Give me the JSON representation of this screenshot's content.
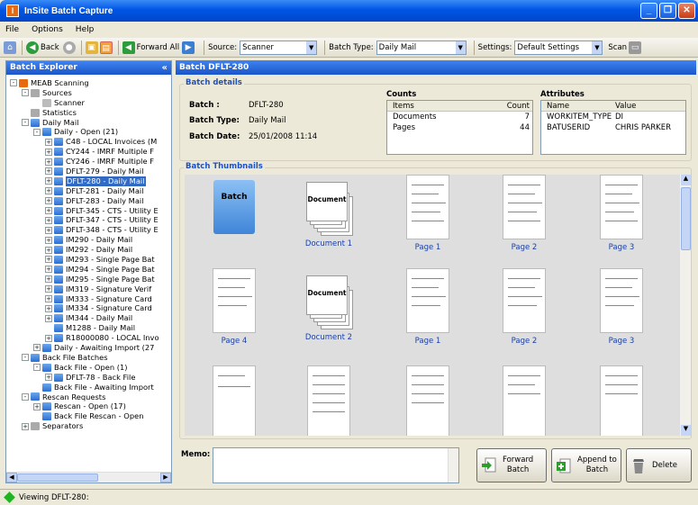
{
  "window": {
    "title": "InSite Batch Capture",
    "app_icon": "I"
  },
  "menu": [
    "File",
    "Options",
    "Help"
  ],
  "toolbar": {
    "back": "Back",
    "forward_all": "Forward All",
    "source_label": "Source:",
    "source_value": "Scanner",
    "batch_type_label": "Batch Type:",
    "batch_type_value": "Daily Mail",
    "settings_label": "Settings:",
    "settings_value": "Default Settings",
    "scan": "Scan"
  },
  "explorer": {
    "title": "Batch Explorer",
    "collapse": "«",
    "tree": [
      {
        "label": "MEAB Scanning",
        "level": 0,
        "pm": "-",
        "icon": "org"
      },
      {
        "label": "Sources",
        "level": 1,
        "pm": "-",
        "icon": "gray"
      },
      {
        "label": "Scanner",
        "level": 2,
        "pm": "",
        "icon": "scan"
      },
      {
        "label": "Statistics",
        "level": 1,
        "pm": "",
        "icon": "gray"
      },
      {
        "label": "Daily Mail",
        "level": 1,
        "pm": "-",
        "icon": "blue"
      },
      {
        "label": "Daily - Open (21)",
        "level": 2,
        "pm": "-",
        "icon": "blue"
      },
      {
        "label": "C48 - LOCAL Invoices (M",
        "level": 3,
        "pm": "+",
        "icon": "blue"
      },
      {
        "label": "CY244 - IMRF Multiple F",
        "level": 3,
        "pm": "+",
        "icon": "blue"
      },
      {
        "label": "CY246 - IMRF Multiple F",
        "level": 3,
        "pm": "+",
        "icon": "blue"
      },
      {
        "label": "DFLT-279 - Daily Mail",
        "level": 3,
        "pm": "+",
        "icon": "blue"
      },
      {
        "label": "DFLT-280 - Daily Mail",
        "level": 3,
        "pm": "+",
        "icon": "blue",
        "selected": true
      },
      {
        "label": "DFLT-281 - Daily Mail",
        "level": 3,
        "pm": "+",
        "icon": "blue"
      },
      {
        "label": "DFLT-283 - Daily Mail",
        "level": 3,
        "pm": "+",
        "icon": "blue"
      },
      {
        "label": "DFLT-345 - CTS - Utility E",
        "level": 3,
        "pm": "+",
        "icon": "blue"
      },
      {
        "label": "DFLT-347 - CTS - Utility E",
        "level": 3,
        "pm": "+",
        "icon": "blue"
      },
      {
        "label": "DFLT-348 - CTS - Utility E",
        "level": 3,
        "pm": "+",
        "icon": "blue"
      },
      {
        "label": "IM290 - Daily Mail",
        "level": 3,
        "pm": "+",
        "icon": "blue"
      },
      {
        "label": "IM292 - Daily Mail",
        "level": 3,
        "pm": "+",
        "icon": "blue"
      },
      {
        "label": "IM293 - Single Page Bat",
        "level": 3,
        "pm": "+",
        "icon": "blue"
      },
      {
        "label": "IM294 - Single Page Bat",
        "level": 3,
        "pm": "+",
        "icon": "blue"
      },
      {
        "label": "IM295 - Single Page Bat",
        "level": 3,
        "pm": "+",
        "icon": "blue"
      },
      {
        "label": "IM319 - Signature Verif",
        "level": 3,
        "pm": "+",
        "icon": "blue"
      },
      {
        "label": "IM333 - Signature Card",
        "level": 3,
        "pm": "+",
        "icon": "blue"
      },
      {
        "label": "IM334 - Signature Card",
        "level": 3,
        "pm": "+",
        "icon": "blue"
      },
      {
        "label": "IM344 - Daily Mail",
        "level": 3,
        "pm": "+",
        "icon": "blue"
      },
      {
        "label": "M1288 - Daily Mail",
        "level": 3,
        "pm": "",
        "icon": "blue"
      },
      {
        "label": "R18000080 - LOCAL Invo",
        "level": 3,
        "pm": "+",
        "icon": "blue"
      },
      {
        "label": "Daily - Awaiting Import (27",
        "level": 2,
        "pm": "+",
        "icon": "blue"
      },
      {
        "label": "Back File Batches",
        "level": 1,
        "pm": "-",
        "icon": "blue"
      },
      {
        "label": "Back File - Open (1)",
        "level": 2,
        "pm": "-",
        "icon": "blue"
      },
      {
        "label": "DFLT-78 - Back File",
        "level": 3,
        "pm": "+",
        "icon": "blue"
      },
      {
        "label": "Back File - Awaiting Import",
        "level": 2,
        "pm": "",
        "icon": "blue"
      },
      {
        "label": "Rescan Requests",
        "level": 1,
        "pm": "-",
        "icon": "blue"
      },
      {
        "label": "Rescan - Open (17)",
        "level": 2,
        "pm": "+",
        "icon": "blue"
      },
      {
        "label": "Back File Rescan - Open",
        "level": 2,
        "pm": "",
        "icon": "blue"
      },
      {
        "label": "Separators",
        "level": 1,
        "pm": "+",
        "icon": "gray"
      }
    ]
  },
  "main": {
    "header": "Batch DFLT-280",
    "details": {
      "title": "Batch details",
      "batch_label": "Batch :",
      "batch_value": "DFLT-280",
      "type_label": "Batch Type:",
      "type_value": "Daily Mail",
      "date_label": "Batch Date:",
      "date_value": "25/01/2008 11:14"
    },
    "counts": {
      "title": "Counts",
      "headers": [
        "Items",
        "Count"
      ],
      "rows": [
        [
          "Documents",
          "7"
        ],
        [
          "Pages",
          "44"
        ]
      ]
    },
    "attributes": {
      "title": "Attributes",
      "headers": [
        "Name",
        "Value"
      ],
      "rows": [
        [
          "WORKITEM_TYPE",
          "DI"
        ],
        [
          "BATUSERID",
          "CHRIS PARKER"
        ]
      ]
    },
    "thumbnails": {
      "title": "Batch Thumbnails",
      "batch_icon_text": "Batch",
      "doc_icon_text": "Document",
      "row1": [
        "",
        "Document 1",
        "Page 1",
        "Page 2",
        "Page 3"
      ],
      "row2": [
        "Page 4",
        "Document 2",
        "Page 1",
        "Page 2",
        "Page 3"
      ]
    },
    "memo_label": "Memo:",
    "buttons": {
      "forward": [
        "Forward",
        "Batch"
      ],
      "append": [
        "Append to",
        "Batch"
      ],
      "delete": "Delete"
    }
  },
  "status": "Viewing DFLT-280:"
}
